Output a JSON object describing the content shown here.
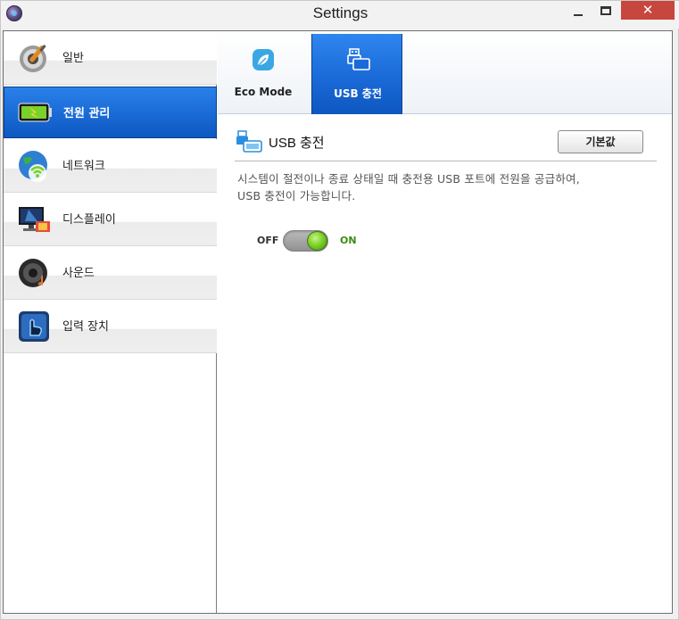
{
  "window": {
    "title": "Settings",
    "close_glyph": "✕",
    "icons": {
      "app": "app-logo-icon",
      "minimize": "minimize-icon",
      "maximize": "maximize-icon",
      "close": "close-icon"
    }
  },
  "sidebar": {
    "items": [
      {
        "label": "일반",
        "icon": "gear-wrench-icon",
        "active": false
      },
      {
        "label": "전원 관리",
        "icon": "battery-icon",
        "active": true
      },
      {
        "label": "네트워크",
        "icon": "globe-wifi-icon",
        "active": false
      },
      {
        "label": "디스플레이",
        "icon": "monitor-icon",
        "active": false
      },
      {
        "label": "사운드",
        "icon": "speaker-icon",
        "active": false
      },
      {
        "label": "입력 장치",
        "icon": "touch-hand-icon",
        "active": false
      }
    ]
  },
  "tabs": [
    {
      "label": "Eco Mode",
      "icon": "leaf-icon",
      "active": false
    },
    {
      "label": "USB 충전",
      "icon": "usb-device-icon",
      "active": true
    }
  ],
  "main": {
    "section_title": "USB 충전",
    "section_icon": "usb-charge-icon",
    "default_button": "기본값",
    "description_line1": "시스템이 절전이나 종료 상태일 때 충전용 USB 포트에 전원을 공급하여,",
    "description_line2": "USB 충전이 가능합니다.",
    "toggle": {
      "off_label": "OFF",
      "on_label": "ON",
      "state": "on"
    }
  },
  "colors": {
    "accent_blue": "#1b6cd8",
    "close_red": "#c7463e",
    "toggle_green": "#7fd22a",
    "on_text_green": "#3b8c12"
  }
}
